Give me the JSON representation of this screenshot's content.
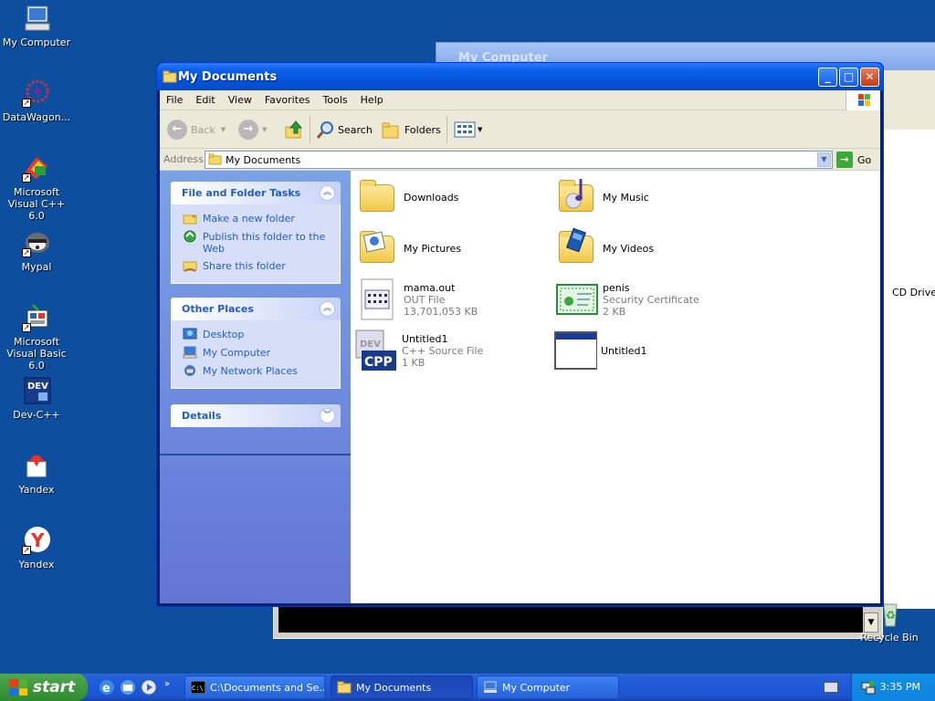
{
  "desktop": {
    "icons": [
      {
        "label": "My Computer"
      },
      {
        "label": "DataWagon..."
      },
      {
        "label": "Microsoft Visual C++ 6.0"
      },
      {
        "label": "Mypal"
      },
      {
        "label": "Microsoft Visual Basic 6.0"
      },
      {
        "label": "Dev-C++"
      },
      {
        "label": "Yandex"
      },
      {
        "label": "Yandex"
      },
      {
        "label": "Recycle Bin"
      }
    ],
    "background_window": {
      "title": "My Computer",
      "cd_drive_label": "CD Drive ("
    }
  },
  "window": {
    "title": "My Documents",
    "menu": [
      "File",
      "Edit",
      "View",
      "Favorites",
      "Tools",
      "Help"
    ],
    "toolbar": {
      "back": "Back",
      "search": "Search",
      "folders": "Folders"
    },
    "address": {
      "label": "Address",
      "value": "My Documents",
      "go": "Go"
    },
    "task_pane": {
      "file_folder_tasks": {
        "title": "File and Folder Tasks",
        "items": [
          "Make a new folder",
          "Publish this folder to the Web",
          "Share this folder"
        ]
      },
      "other_places": {
        "title": "Other Places",
        "items": [
          "Desktop",
          "My Computer",
          "My Network Places"
        ]
      },
      "details": {
        "title": "Details"
      }
    },
    "files": [
      {
        "name": "Downloads",
        "type": "",
        "size": "",
        "icon": "folder-icon"
      },
      {
        "name": "My Music",
        "type": "",
        "size": "",
        "icon": "music-folder-icon"
      },
      {
        "name": "My Pictures",
        "type": "",
        "size": "",
        "icon": "pictures-folder-icon"
      },
      {
        "name": "My Videos",
        "type": "",
        "size": "",
        "icon": "videos-folder-icon"
      },
      {
        "name": "mama.out",
        "type": "OUT File",
        "size": "13,701,053 KB",
        "icon": "file-icon"
      },
      {
        "name": "penis",
        "type": "Security Certificate",
        "size": "2 KB",
        "icon": "certificate-icon"
      },
      {
        "name": "Untitled1",
        "type": "C++ Source File",
        "size": "1 KB",
        "icon": "cpp-file-icon"
      },
      {
        "name": "Untitled1",
        "type": "",
        "size": "",
        "icon": "window-app-icon"
      }
    ]
  },
  "taskbar": {
    "start": "start",
    "buttons": [
      {
        "label": "C:\\Documents and Se..."
      },
      {
        "label": "My Documents"
      },
      {
        "label": "My Computer"
      }
    ],
    "clock": "3:35 PM"
  },
  "colors": {
    "desktop": "#0d4f9e",
    "title_bar": "#0453d6",
    "task_link": "#215dc6",
    "start_button": "#3a963a"
  }
}
